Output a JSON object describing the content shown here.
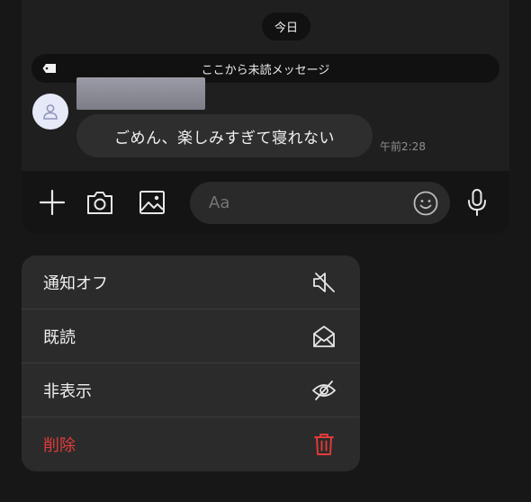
{
  "chat": {
    "date_label": "今日",
    "unread_divider": "ここから未読メッセージ",
    "message": {
      "text": "ごめん、楽しみすぎて寝れない",
      "time": "午前2:28"
    }
  },
  "composer": {
    "placeholder": "Aa"
  },
  "context_menu": {
    "items": [
      {
        "label": "通知オフ",
        "icon": "mute-icon"
      },
      {
        "label": "既読",
        "icon": "open-envelope-icon"
      },
      {
        "label": "非表示",
        "icon": "eye-slash-icon"
      },
      {
        "label": "削除",
        "icon": "trash-icon"
      }
    ],
    "danger_color": "#e33b3b"
  }
}
